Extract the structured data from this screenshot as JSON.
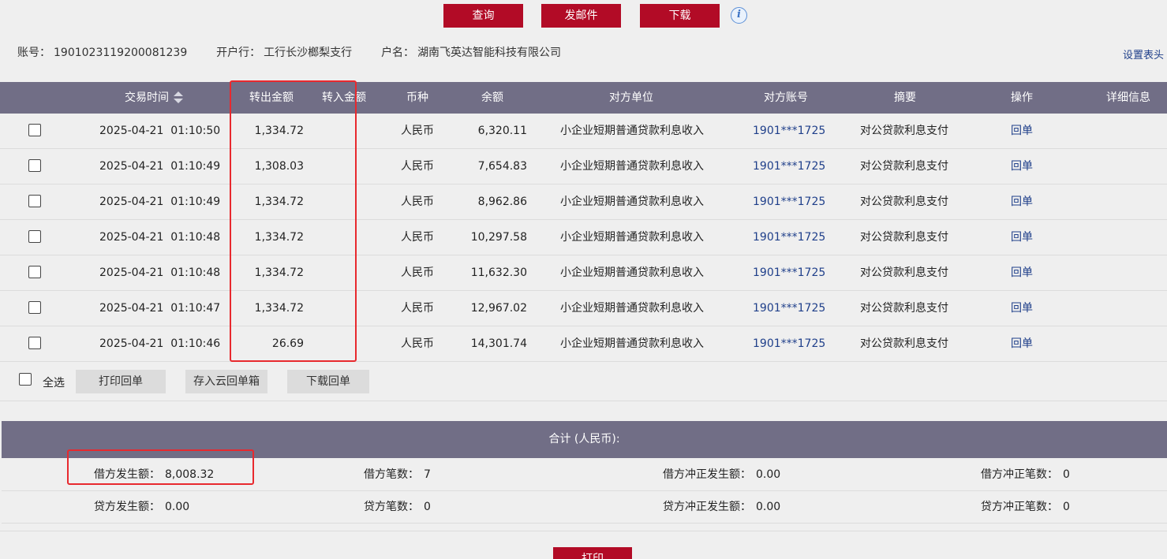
{
  "toolbar": {
    "query_label": "查询",
    "mail_label": "发邮件",
    "download_label": "下载",
    "info_icon": "info-icon",
    "info_glyph": "i"
  },
  "account": {
    "number_label": "账号：",
    "number": "1901023119200081239",
    "bank_label": "开户行：",
    "bank": "工行长沙榔梨支行",
    "holder_label": "户名：",
    "holder": "湖南飞英达智能科技有限公司",
    "set_header_link": "设置表头"
  },
  "table": {
    "headers": {
      "time": "交易时间",
      "debit": "转出金额",
      "credit": "转入金额",
      "currency": "币种",
      "balance": "余额",
      "counterparty": "对方单位",
      "counter_account": "对方账号",
      "memo": "摘要",
      "action": "操作",
      "detail": "详细信息"
    },
    "sort_icon": "sort-icon",
    "rows": [
      {
        "date": "2025-04-21",
        "time": "01:10:50",
        "debit": "1,334.72",
        "currency": "人民币",
        "balance": "6,320.11",
        "counterparty": "小企业短期普通贷款利息收入",
        "counter_account": "1901***1725",
        "memo": "对公贷款利息支付",
        "action": "回单"
      },
      {
        "date": "2025-04-21",
        "time": "01:10:49",
        "debit": "1,308.03",
        "currency": "人民币",
        "balance": "7,654.83",
        "counterparty": "小企业短期普通贷款利息收入",
        "counter_account": "1901***1725",
        "memo": "对公贷款利息支付",
        "action": "回单"
      },
      {
        "date": "2025-04-21",
        "time": "01:10:49",
        "debit": "1,334.72",
        "currency": "人民币",
        "balance": "8,962.86",
        "counterparty": "小企业短期普通贷款利息收入",
        "counter_account": "1901***1725",
        "memo": "对公贷款利息支付",
        "action": "回单"
      },
      {
        "date": "2025-04-21",
        "time": "01:10:48",
        "debit": "1,334.72",
        "currency": "人民币",
        "balance": "10,297.58",
        "counterparty": "小企业短期普通贷款利息收入",
        "counter_account": "1901***1725",
        "memo": "对公贷款利息支付",
        "action": "回单"
      },
      {
        "date": "2025-04-21",
        "time": "01:10:48",
        "debit": "1,334.72",
        "currency": "人民币",
        "balance": "11,632.30",
        "counterparty": "小企业短期普通贷款利息收入",
        "counter_account": "1901***1725",
        "memo": "对公贷款利息支付",
        "action": "回单"
      },
      {
        "date": "2025-04-21",
        "time": "01:10:47",
        "debit": "1,334.72",
        "currency": "人民币",
        "balance": "12,967.02",
        "counterparty": "小企业短期普通贷款利息收入",
        "counter_account": "1901***1725",
        "memo": "对公贷款利息支付",
        "action": "回单"
      },
      {
        "date": "2025-04-21",
        "time": "01:10:46",
        "debit": "26.69",
        "currency": "人民币",
        "balance": "14,301.74",
        "counterparty": "小企业短期普通贷款利息收入",
        "counter_account": "1901***1725",
        "memo": "对公贷款利息支付",
        "action": "回单"
      }
    ]
  },
  "batch": {
    "select_all_label": "全选",
    "print_receipt_label": "打印回单",
    "save_cloud_label": "存入云回单箱",
    "download_receipt_label": "下载回单"
  },
  "summary": {
    "title": "合计 (人民币):",
    "debit_amount_label": "借方发生额：",
    "debit_amount": "8,008.32",
    "debit_count_label": "借方笔数：",
    "debit_count": "7",
    "debit_reversal_amount_label": "借方冲正发生额：",
    "debit_reversal_amount": "0.00",
    "debit_reversal_count_label": "借方冲正笔数：",
    "debit_reversal_count": "0",
    "credit_amount_label": "贷方发生额：",
    "credit_amount": "0.00",
    "credit_count_label": "贷方笔数：",
    "credit_count": "0",
    "credit_reversal_amount_label": "贷方冲正发生额：",
    "credit_reversal_amount": "0.00",
    "credit_reversal_count_label": "贷方冲正笔数：",
    "credit_reversal_count": "0"
  },
  "footer": {
    "print_label": "打印"
  },
  "colors": {
    "brand_red": "#b20b26",
    "header_bg": "#716e86",
    "link_blue": "#1f3f8a",
    "highlight_red": "#e8292e",
    "page_bg": "#efefef"
  }
}
